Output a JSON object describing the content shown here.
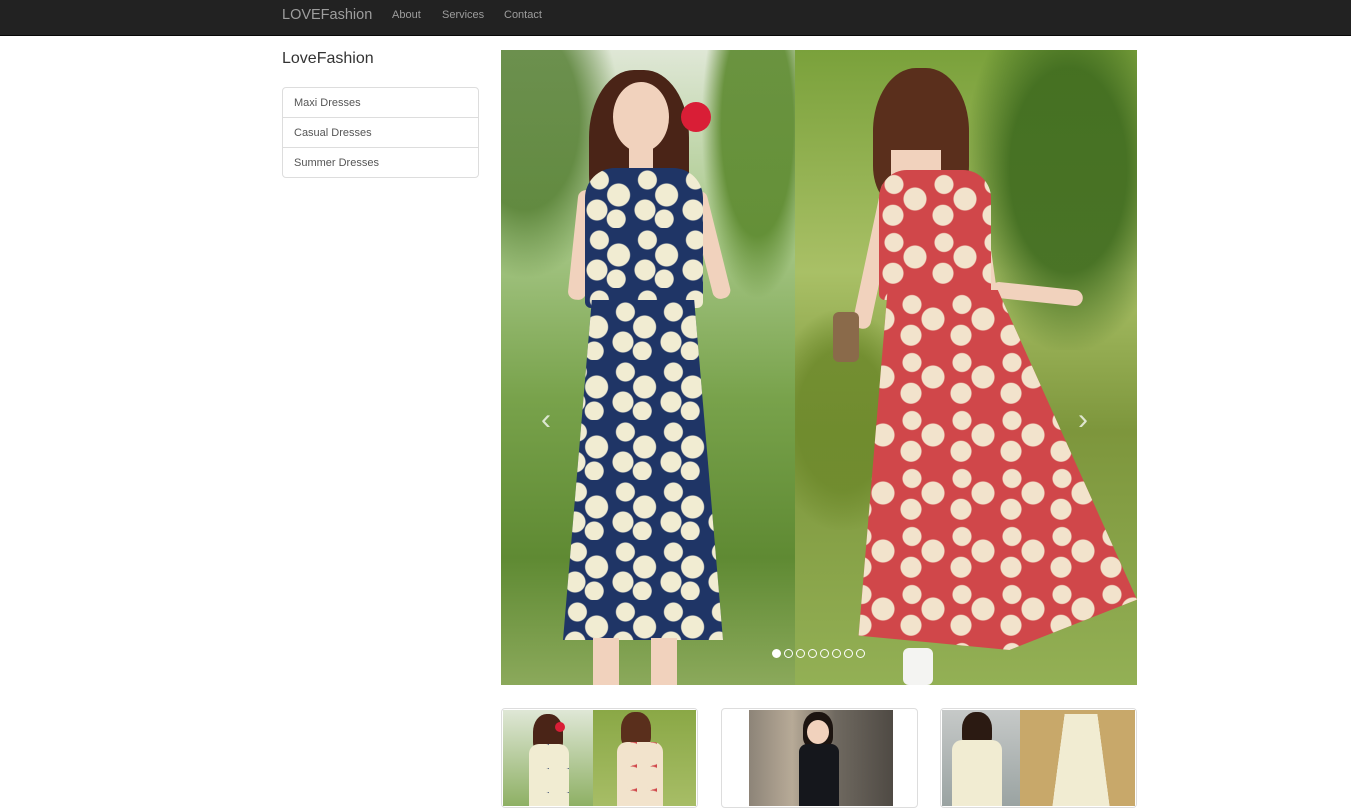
{
  "navbar": {
    "brand": "LOVEFashion",
    "links": [
      "About",
      "Services",
      "Contact"
    ]
  },
  "sidebar": {
    "title": "LoveFashion",
    "items": [
      {
        "label": "Maxi Dresses"
      },
      {
        "label": "Casual Dresses"
      },
      {
        "label": "Summer Dresses"
      }
    ]
  },
  "carousel": {
    "prev_icon": "chevron-left-icon",
    "next_icon": "chevron-right-icon",
    "slide_count": 8,
    "active_slide": 1
  },
  "thumbnails": [
    {
      "icon": "dress-photo"
    },
    {
      "icon": "dress-photo"
    },
    {
      "icon": "dress-photo"
    }
  ]
}
